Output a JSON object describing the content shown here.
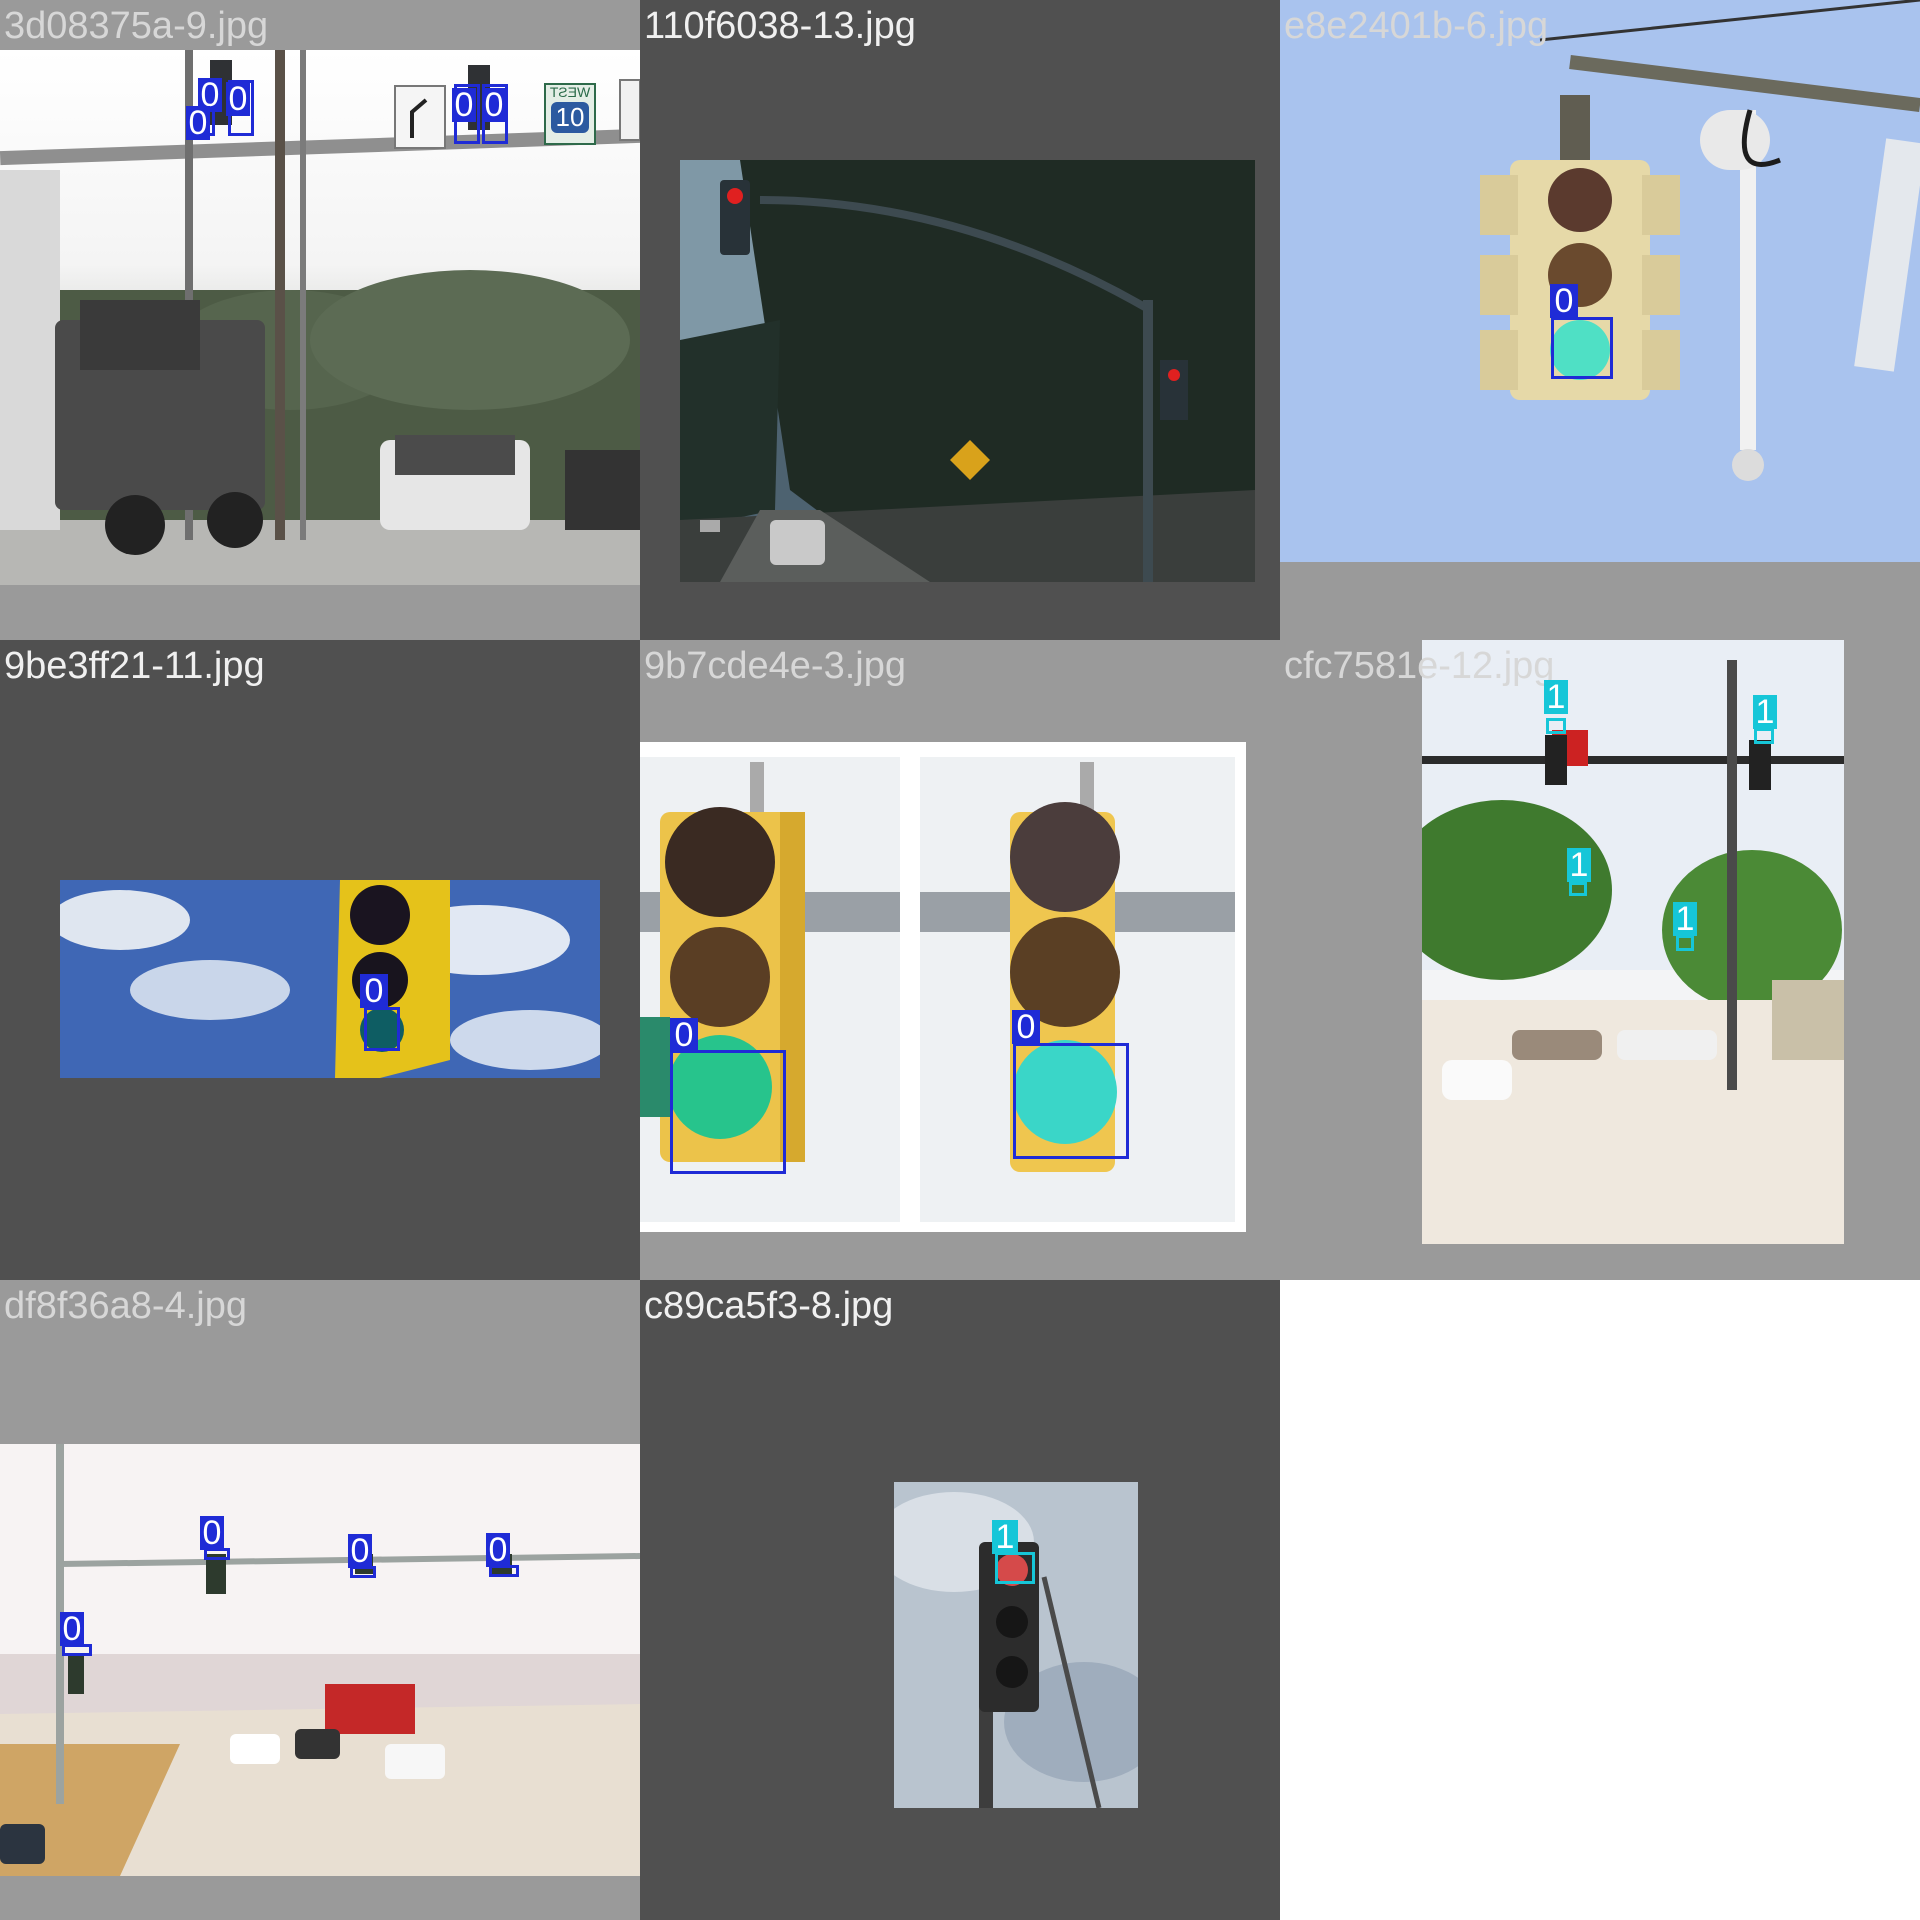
{
  "colors": {
    "class_0": "#1f2bd6",
    "class_1": "#16c6d8",
    "tile_light": "#9a9a9a",
    "tile_dark": "#505050",
    "label_light_text": "#d7d7d7",
    "label_dark_text": "#f0f0f0"
  },
  "tiles": [
    {
      "filename": "3d08375a-9.jpg",
      "labels": [
        "0",
        "0",
        "0",
        "0",
        "0"
      ]
    },
    {
      "filename": "110f6038-13.jpg",
      "labels": []
    },
    {
      "filename": "e8e2401b-6.jpg",
      "labels": [
        "0"
      ]
    },
    {
      "filename": "9be3ff21-11.jpg",
      "labels": [
        "0"
      ]
    },
    {
      "filename": "9b7cde4e-3.jpg",
      "labels": [
        "0",
        "0"
      ]
    },
    {
      "filename": "cfc7581e-12.jpg",
      "labels": [
        "1",
        "1",
        "1",
        "1"
      ]
    },
    {
      "filename": "df8f36a8-4.jpg",
      "labels": [
        "0",
        "0",
        "0",
        "0"
      ]
    },
    {
      "filename": "c89ca5f3-8.jpg",
      "labels": [
        "1"
      ]
    }
  ],
  "signs": {
    "route_top": "WEST",
    "route_number": "10"
  }
}
